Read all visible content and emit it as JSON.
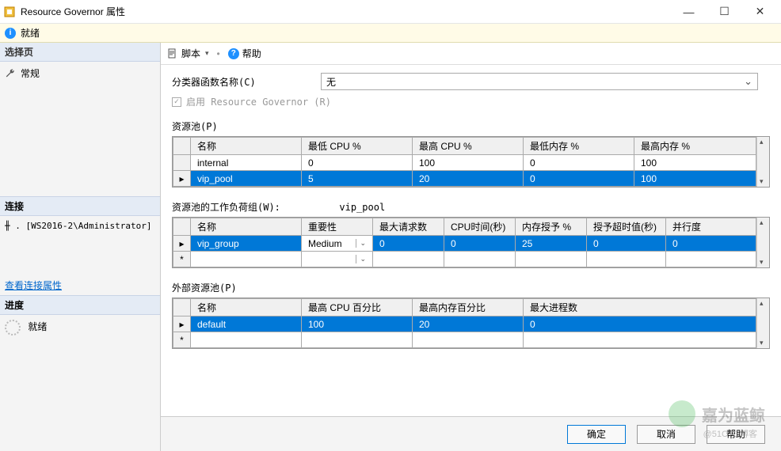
{
  "window": {
    "title": "Resource Governor 属性",
    "min": "—",
    "max": "☐",
    "close": "✕"
  },
  "status": {
    "ready": "就绪"
  },
  "sidebar": {
    "select_page": "选择页",
    "general": "常规",
    "connection": "连接",
    "conn_value": ". [WS2016-2\\Administrator]",
    "view_conn_props": "查看连接属性",
    "progress": "进度",
    "ready": "就绪"
  },
  "toolbar": {
    "script": "脚本",
    "help": "帮助"
  },
  "form": {
    "classifier_label": "分类器函数名称(C)",
    "classifier_value": "无",
    "enable_rg": "启用 Resource Governor (R)"
  },
  "pool_section": {
    "label": "资源池(P)",
    "headers": {
      "name": "名称",
      "min_cpu": "最低 CPU %",
      "max_cpu": "最高 CPU %",
      "min_mem": "最低内存 %",
      "max_mem": "最高内存 %"
    },
    "rows": [
      {
        "name": "internal",
        "min_cpu": "0",
        "max_cpu": "100",
        "min_mem": "0",
        "max_mem": "100",
        "selected": false
      },
      {
        "name": "vip_pool",
        "min_cpu": "5",
        "max_cpu": "20",
        "min_mem": "0",
        "max_mem": "100",
        "selected": true
      }
    ]
  },
  "workload_section": {
    "label": "资源池的工作负荷组(W):",
    "pool_name": "vip_pool",
    "headers": {
      "name": "名称",
      "importance": "重要性",
      "max_req": "最大请求数",
      "cpu_time": "CPU时间(秒)",
      "mem_grant": "内存授予 %",
      "grant_timeout": "授予超时值(秒)",
      "dop": "并行度"
    },
    "rows": [
      {
        "name": "vip_group",
        "importance": "Medium",
        "max_req": "0",
        "cpu_time": "0",
        "mem_grant": "25",
        "grant_timeout": "0",
        "dop": "0",
        "selected": true
      }
    ]
  },
  "ext_section": {
    "label": "外部资源池(P)",
    "headers": {
      "name": "名称",
      "max_cpu": "最高 CPU 百分比",
      "max_mem": "最高内存百分比",
      "max_proc": "最大进程数"
    },
    "rows": [
      {
        "name": "default",
        "max_cpu": "100",
        "max_mem": "20",
        "max_proc": "0",
        "selected": true
      }
    ]
  },
  "buttons": {
    "ok": "确定",
    "cancel": "取消",
    "help": "帮助"
  },
  "watermark": {
    "text": "嘉为蓝鲸",
    "sub": "@51CTO博客"
  }
}
